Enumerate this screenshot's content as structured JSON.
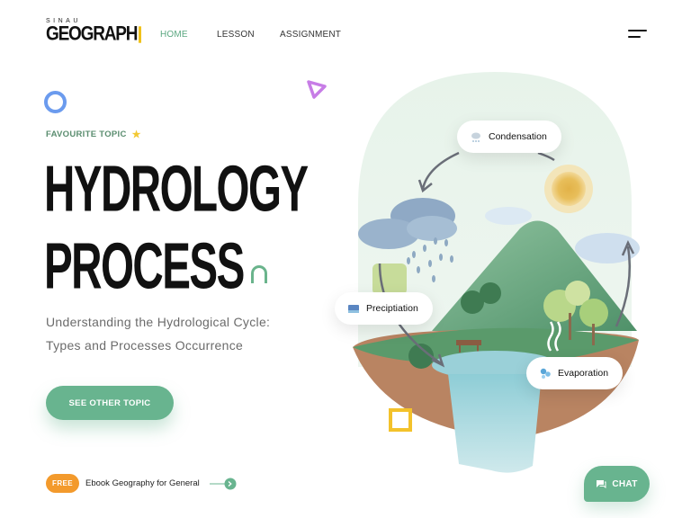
{
  "brand": {
    "tagline": "SINAU",
    "name": "GEOGRAPH",
    "accent": "#f0c21b"
  },
  "nav": {
    "items": [
      {
        "label": "HOME",
        "active": true
      },
      {
        "label": "LESSON",
        "active": false
      },
      {
        "label": "ASSIGNMENT",
        "active": false
      }
    ],
    "menu_icon": "hamburger-menu-icon"
  },
  "hero": {
    "eyebrow": "FAVOURITE TOPIC",
    "eyebrow_icon": "star-icon",
    "title_line1": "HYDROLOGY",
    "title_line2": "PROCESS",
    "subtitle_line1": "Understanding the Hydrological Cycle:",
    "subtitle_line2": "Types and Processes Occurrence",
    "cta_label": "SEE OTHER TOPIC"
  },
  "promo": {
    "badge": "FREE",
    "text": "Ebook Geography for General"
  },
  "illustration": {
    "labels": {
      "condensation": "Condensation",
      "precipitation": "Preciptiation",
      "evaporation": "Evaporation"
    }
  },
  "chat": {
    "label": "CHAT",
    "icon": "chat-bubble-icon"
  },
  "colors": {
    "primary_green": "#68b48f",
    "orange": "#f39a2c",
    "blue_ring": "#6b9bee",
    "yellow": "#f3c22b",
    "purple": "#c77de6"
  }
}
